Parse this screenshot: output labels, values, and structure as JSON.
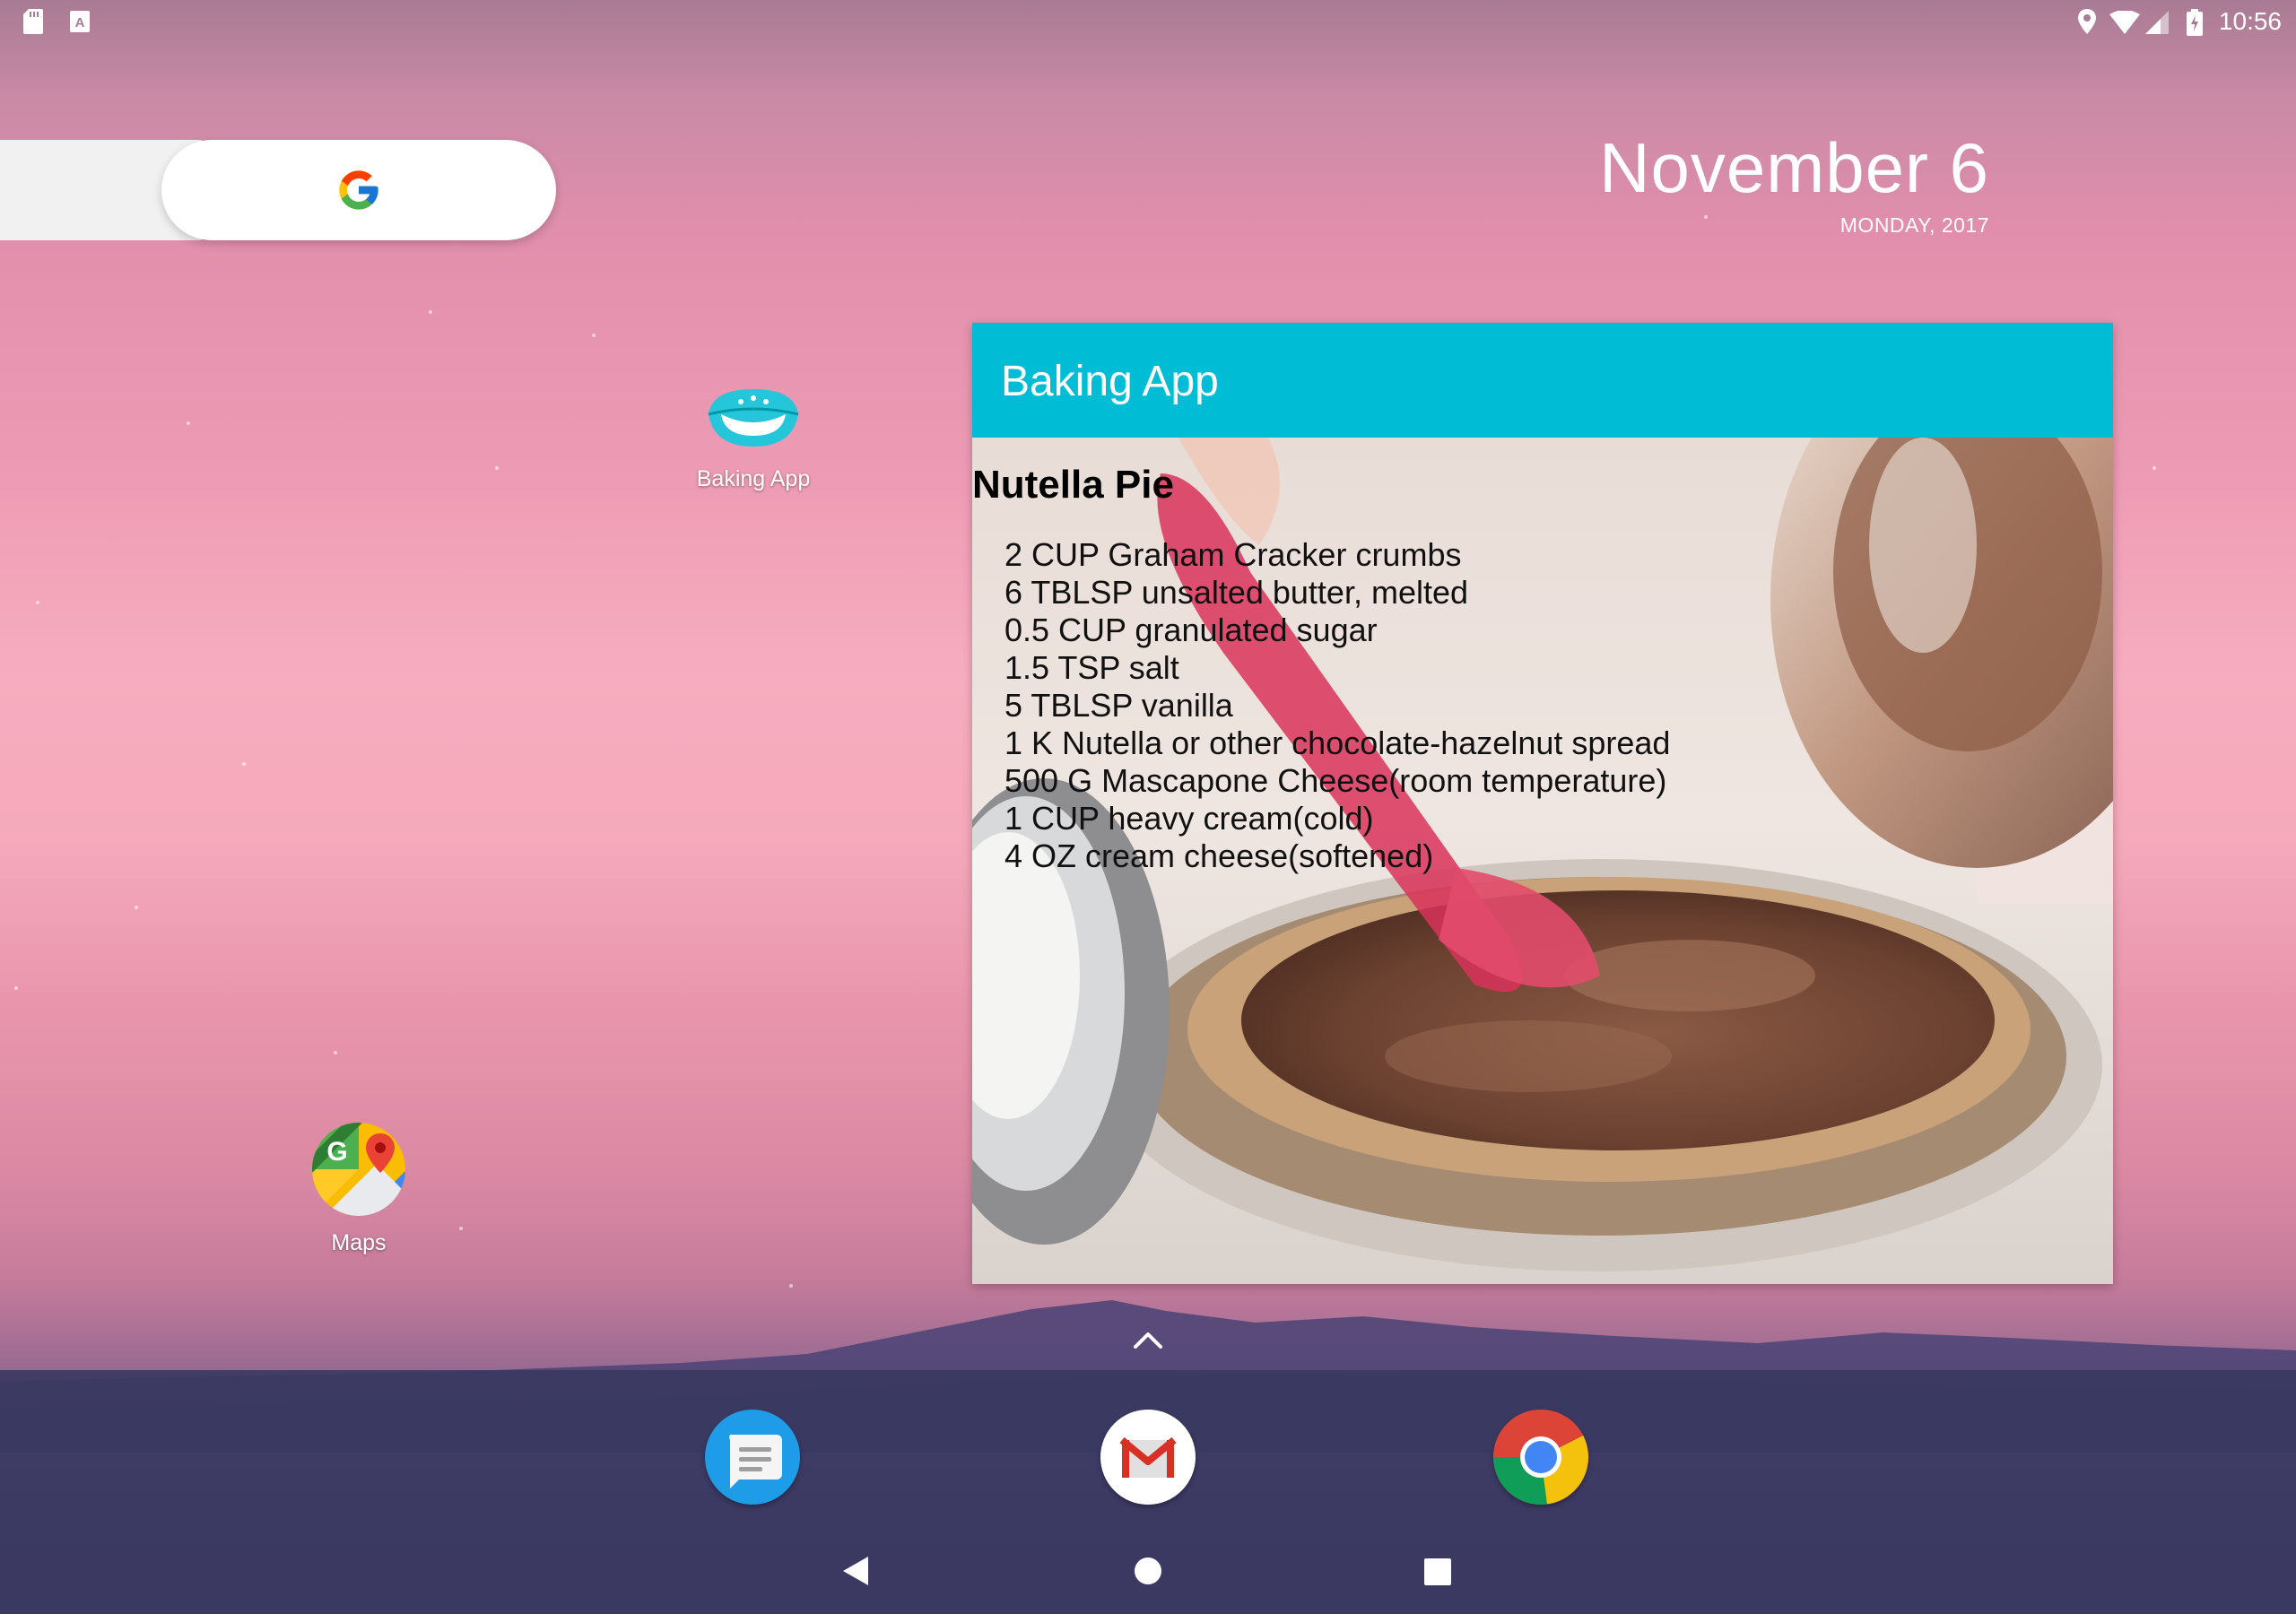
{
  "status_bar": {
    "time": "10:56",
    "left_icons": [
      "sd-card-icon",
      "keyboard-a-icon"
    ],
    "right_icons": [
      "location-icon",
      "wifi-icon",
      "signal-icon",
      "battery-charging-icon"
    ]
  },
  "search": {
    "logo": "google-g-icon"
  },
  "date_widget": {
    "date": "November 6",
    "day": "MONDAY, 2017"
  },
  "desktop_apps": [
    {
      "label": "Baking App",
      "icon": "baking-app-icon"
    },
    {
      "label": "Maps",
      "icon": "maps-icon"
    }
  ],
  "baking_widget": {
    "title": "Baking App",
    "recipe_name": "Nutella Pie",
    "ingredients": [
      "2 CUP Graham Cracker crumbs",
      "6 TBLSP unsalted butter, melted",
      "0.5 CUP granulated sugar",
      "1.5 TSP salt",
      "5 TBLSP vanilla",
      "1 K Nutella or other chocolate-hazelnut spread",
      "500 G Mascapone Cheese(room temperature)",
      "1 CUP heavy cream(cold)",
      "4 OZ cream cheese(softened)"
    ],
    "header_color": "#00bcd4"
  },
  "dock": {
    "apps": [
      "messages-icon",
      "gmail-icon",
      "chrome-icon"
    ]
  },
  "nav_bar": [
    "back-button",
    "home-button",
    "recents-button"
  ],
  "colors": {
    "accent": "#00bcd4"
  }
}
